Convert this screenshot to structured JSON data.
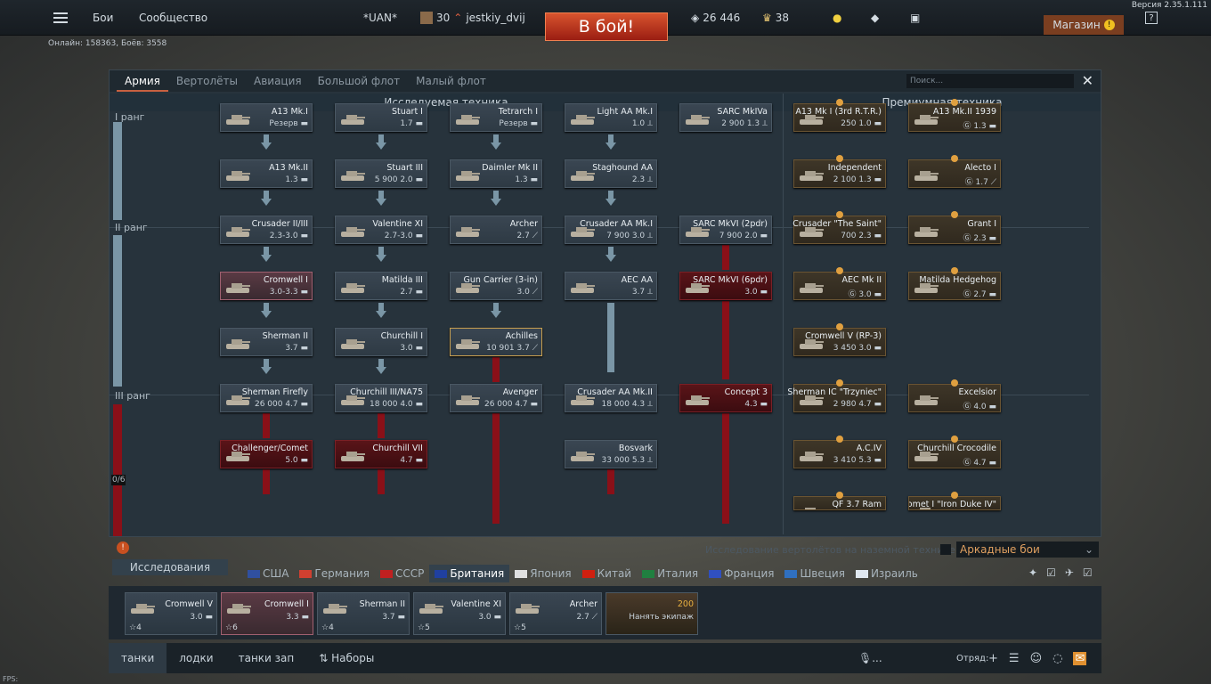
{
  "version": "Версия 2.35.1.111",
  "online": "Онлайн: 158363, Боёв: 3558",
  "topbar": {
    "battles": "Бои",
    "community": "Сообщество",
    "squad": "*UAN*",
    "level": "30",
    "username": "jestkiy_dvij",
    "battle_button": "В бой!",
    "silver": "26 446",
    "gold": "38",
    "shop": "Магазин",
    "shop_warn": "!",
    "help": "?"
  },
  "tabs": [
    "Армия",
    "Вертолёты",
    "Авиация",
    "Большой флот",
    "Малый флот"
  ],
  "search_placeholder": "Поиск...",
  "headers": {
    "research": "Исследуемая техника",
    "premium": "Премиумная техника"
  },
  "ranks": {
    "r1": "I ранг",
    "r2": "II ранг",
    "r3": "III ранг",
    "progress": "0/6"
  },
  "cards": [
    {
      "n": "A13 Mk.I",
      "v": "Резерв ▬"
    },
    {
      "n": "Stuart I",
      "v": "1.7 ▬"
    },
    {
      "n": "Tetrarch I",
      "v": "Резерв ▬"
    },
    {
      "n": "Light AA Mk.I",
      "v": "1.0 ⟂"
    },
    {
      "n": "SARC MkIVa",
      "v": "2 900 1.3 ⟂"
    },
    {
      "n": "A13 Mk.II",
      "v": "1.3 ▬"
    },
    {
      "n": "Stuart III",
      "v": "5 900 2.0 ▬"
    },
    {
      "n": "Daimler Mk II",
      "v": "1.3 ▬"
    },
    {
      "n": "Staghound AA",
      "v": "2.3 ⟂"
    },
    {
      "n": "Crusader II/III",
      "v": "2.3-3.0 ▬"
    },
    {
      "n": "Valentine XI",
      "v": "2.7-3.0 ▬"
    },
    {
      "n": "Archer",
      "v": "2.7 ⟋"
    },
    {
      "n": "Crusader AA Mk.I",
      "v": "7 900 3.0 ⟂"
    },
    {
      "n": "SARC MkVI (2pdr)",
      "v": "7 900 2.0 ▬"
    },
    {
      "n": "Cromwell I",
      "v": "3.0-3.3 ▬"
    },
    {
      "n": "Matilda III",
      "v": "2.7 ▬"
    },
    {
      "n": "Gun Carrier (3-in)",
      "v": "3.0 ⟋"
    },
    {
      "n": "AEC AA",
      "v": "3.7 ⟂"
    },
    {
      "n": "SARC MkVI (6pdr)",
      "v": "3.0 ▬"
    },
    {
      "n": "Sherman II",
      "v": "3.7 ▬"
    },
    {
      "n": "Churchill I",
      "v": "3.0 ▬"
    },
    {
      "n": "Achilles",
      "v": "10 901 3.7 ⟋"
    },
    {
      "n": "Sherman Firefly",
      "v": "26 000 4.7 ▬"
    },
    {
      "n": "Churchill III/NA75",
      "v": "18 000 4.0 ▬"
    },
    {
      "n": "Avenger",
      "v": "26 000 4.7 ▬"
    },
    {
      "n": "Crusader AA Mk.II",
      "v": "18 000 4.3 ⟂"
    },
    {
      "n": "Concept 3",
      "v": "4.3 ▬"
    },
    {
      "n": "Challenger/Comet",
      "v": "5.0 ▬"
    },
    {
      "n": "Churchill VII",
      "v": "4.7 ▬"
    },
    {
      "n": "Bosvark",
      "v": "33 000 5.3 ⟂"
    }
  ],
  "premium": [
    {
      "n": "A13 Mk I (3rd R.T.R.)",
      "v": "250 1.0 ▬"
    },
    {
      "n": "A13 Mk.II 1939",
      "v": "Ⓖ 1.3 ▬"
    },
    {
      "n": "Independent",
      "v": "2 100 1.3 ▬"
    },
    {
      "n": "Alecto I",
      "v": "Ⓖ 1.7 ⟋"
    },
    {
      "n": "Crusader \"The Saint\"",
      "v": "700 2.3 ▬"
    },
    {
      "n": "Grant I",
      "v": "Ⓖ 2.3 ▬"
    },
    {
      "n": "AEC Mk II",
      "v": "Ⓖ 3.0 ▬"
    },
    {
      "n": "Matilda Hedgehog",
      "v": "Ⓖ 2.7 ▬"
    },
    {
      "n": "Cromwell V (RP-3)",
      "v": "3 450 3.0 ▬"
    },
    {
      "n": "Sherman IC \"Trzyniec\"",
      "v": "2 980 4.7 ▬"
    },
    {
      "n": "Excelsior",
      "v": "Ⓖ 4.0 ▬"
    },
    {
      "n": "A.C.IV",
      "v": "3 410 5.3 ▬"
    },
    {
      "n": "Churchill Crocodile",
      "v": "Ⓖ 4.7 ▬"
    },
    {
      "n": "QF 3.7 Ram",
      "v": ""
    },
    {
      "n": "Comet I \"Iron Duke IV\"",
      "v": ""
    }
  ],
  "heli_note": "Исследование вертолётов на наземной технике",
  "mode": "Аркадные бои",
  "research_btn": "Исследования",
  "nations": [
    "США",
    "Германия",
    "СССР",
    "Британия",
    "Япония",
    "Китай",
    "Италия",
    "Франция",
    "Швеция",
    "Израиль"
  ],
  "slots": [
    {
      "n": "Cromwell V",
      "v": "3.0 ▬",
      "c": "4"
    },
    {
      "n": "Cromwell I",
      "v": "3.3 ▬",
      "c": "6"
    },
    {
      "n": "Sherman II",
      "v": "3.7 ▬",
      "c": "4"
    },
    {
      "n": "Valentine XI",
      "v": "3.0 ▬",
      "c": "5"
    },
    {
      "n": "Archer",
      "v": "2.7 ⟋",
      "c": "5"
    }
  ],
  "crew": {
    "cost": "200",
    "label": "Нанять экипаж"
  },
  "presets": [
    "танки",
    "лодки",
    "танки зап",
    "Наборы"
  ],
  "squad_label": "Отряд:",
  "voice": "...",
  "fps": "FPS:"
}
